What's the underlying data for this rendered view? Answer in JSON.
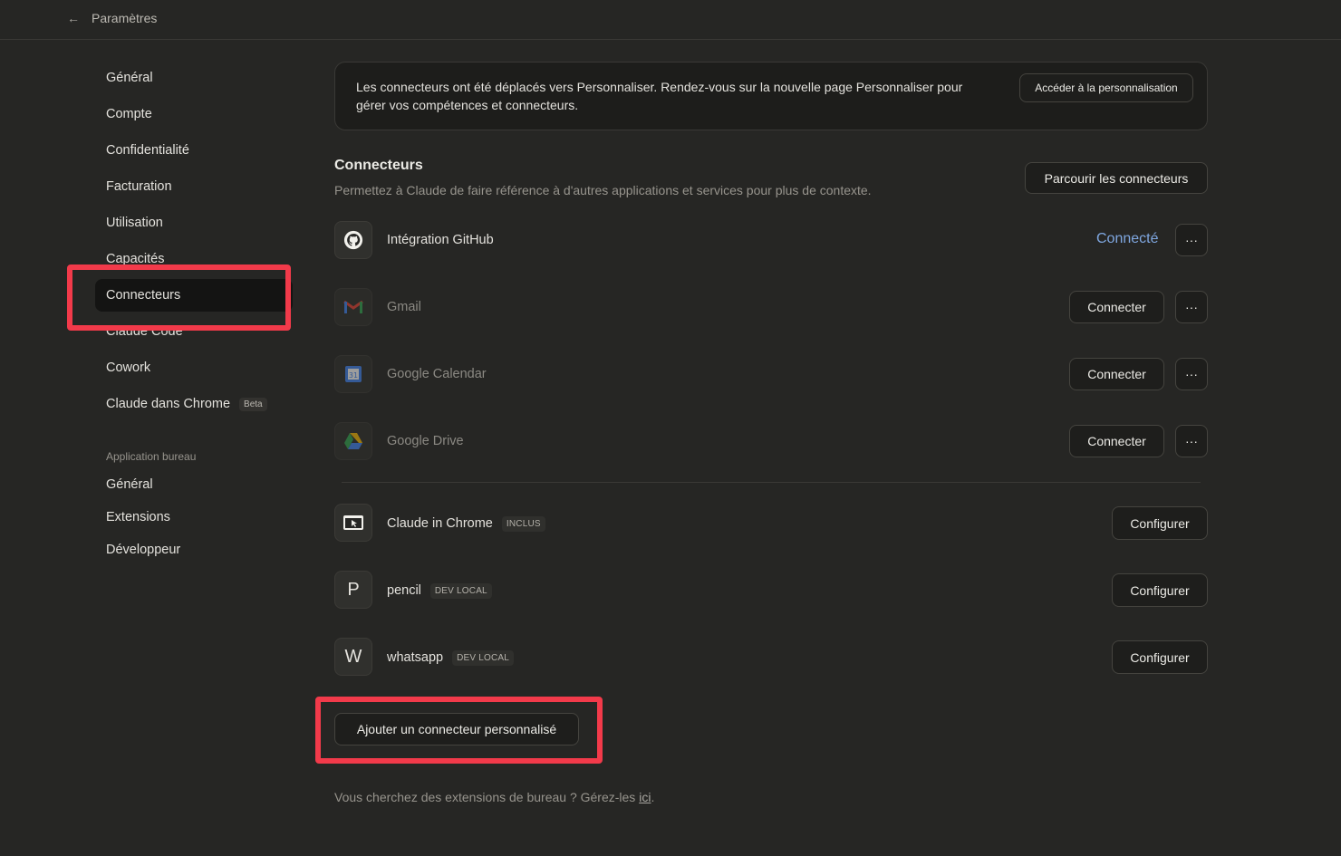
{
  "header": {
    "back_icon": "←",
    "title": "Paramètres"
  },
  "sidebar": {
    "items": [
      {
        "label": "Général"
      },
      {
        "label": "Compte"
      },
      {
        "label": "Confidentialité"
      },
      {
        "label": "Facturation"
      },
      {
        "label": "Utilisation"
      },
      {
        "label": "Capacités"
      },
      {
        "label": "Connecteurs"
      },
      {
        "label": "Claude Code"
      },
      {
        "label": "Cowork"
      },
      {
        "label": "Claude dans Chrome",
        "badge": "Beta"
      }
    ],
    "desktop_section": "Application bureau",
    "desktop_items": [
      {
        "label": "Général"
      },
      {
        "label": "Extensions"
      },
      {
        "label": "Développeur"
      }
    ]
  },
  "banner": {
    "text": "Les connecteurs ont été déplacés vers Personnaliser. Rendez-vous sur la nouvelle page Personnaliser pour gérer vos compétences et connecteurs.",
    "button": "Accéder à la personnalisation"
  },
  "connectors": {
    "title": "Connecteurs",
    "subtitle": "Permettez à Claude de faire référence à d'autres applications et services pour plus de contexte.",
    "browse_button": "Parcourir les connecteurs",
    "more_label": "···",
    "list": [
      {
        "name": "Intégration GitHub",
        "status": "Connecté"
      },
      {
        "name": "Gmail",
        "action": "Connecter"
      },
      {
        "name": "Google Calendar",
        "action": "Connecter"
      },
      {
        "name": "Google Drive",
        "action": "Connecter"
      }
    ],
    "local": [
      {
        "name": "Claude in Chrome",
        "tag": "INCLUS",
        "action": "Configurer"
      },
      {
        "name": "pencil",
        "tag": "DEV LOCAL",
        "action": "Configurer",
        "letter": "P"
      },
      {
        "name": "whatsapp",
        "tag": "DEV LOCAL",
        "action": "Configurer",
        "letter": "W"
      }
    ],
    "add_button": "Ajouter un connecteur personnalisé"
  },
  "footer": {
    "text": "Vous cherchez des extensions de bureau ? Gérez-les ",
    "link": "ici",
    "end": "."
  },
  "colors": {
    "background": "#262624",
    "highlight": "#f23a4a",
    "connected": "#7fa7e0"
  }
}
